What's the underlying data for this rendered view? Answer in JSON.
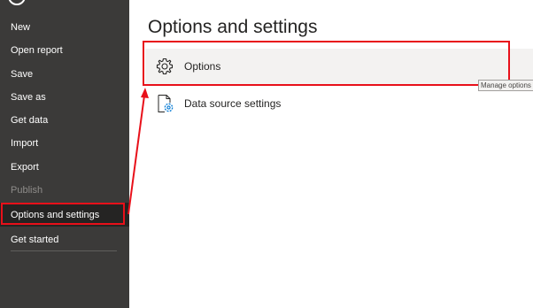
{
  "sidebar": {
    "items": [
      {
        "label": "New"
      },
      {
        "label": "Open report"
      },
      {
        "label": "Save"
      },
      {
        "label": "Save as"
      },
      {
        "label": "Get data"
      },
      {
        "label": "Import"
      },
      {
        "label": "Export"
      },
      {
        "label": "Publish",
        "disabled": true
      },
      {
        "label": "Options and settings",
        "selected": true
      },
      {
        "label": "Get started"
      }
    ],
    "background_color": "#3b3a39",
    "selected_color": "#252423"
  },
  "main": {
    "title": "Options and settings",
    "options": [
      {
        "label": "Options",
        "icon": "gear-icon"
      },
      {
        "label": "Data source settings",
        "icon": "data-source-settings-icon"
      }
    ],
    "tooltip": "Manage options"
  },
  "annotation": {
    "highlight_color": "#e8101a"
  }
}
